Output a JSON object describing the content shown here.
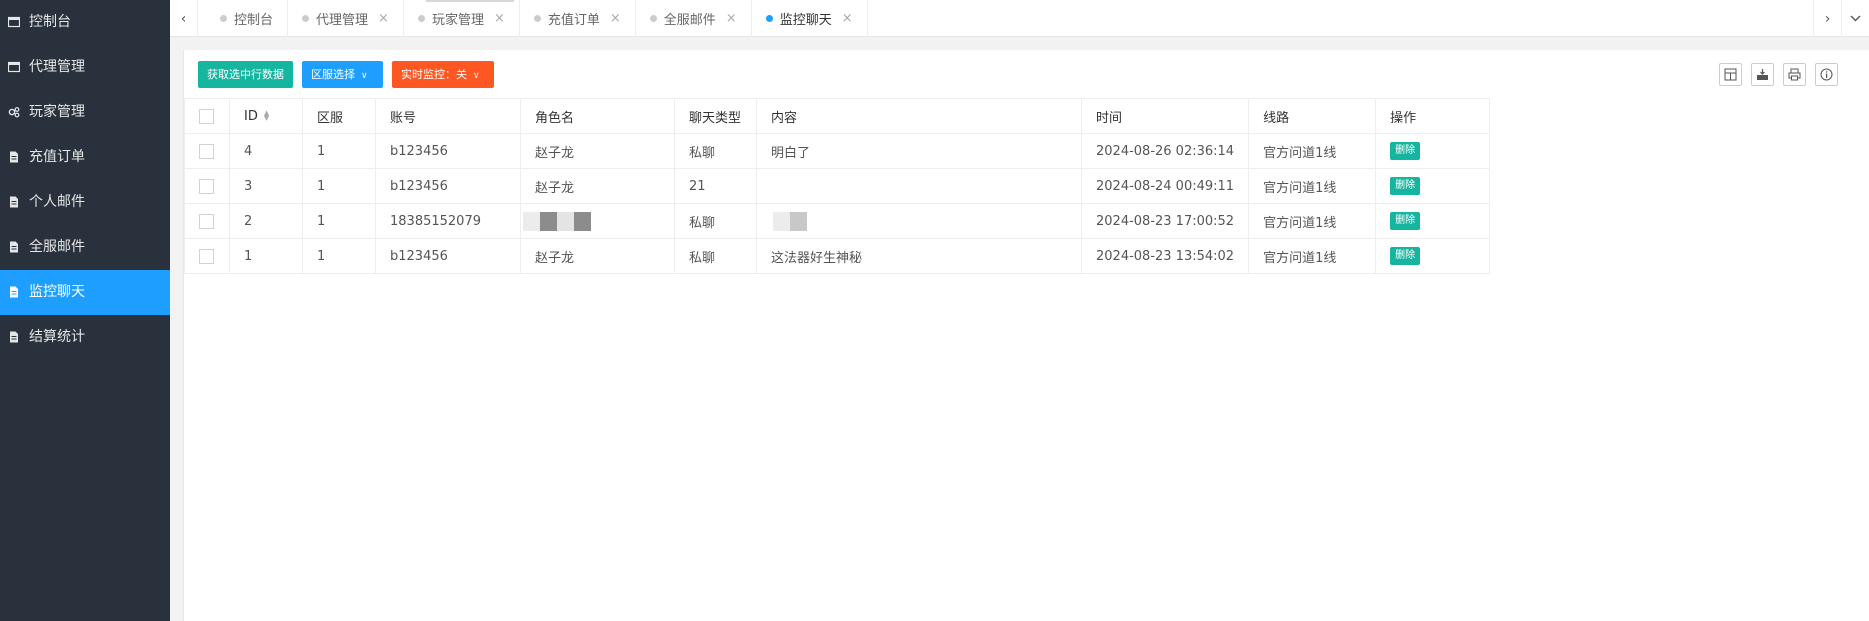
{
  "sidebar": {
    "items": [
      {
        "label": "控制台",
        "icon": "window-icon"
      },
      {
        "label": "代理管理",
        "icon": "window-icon"
      },
      {
        "label": "玩家管理",
        "icon": "gears-icon"
      },
      {
        "label": "充值订单",
        "icon": "file-icon"
      },
      {
        "label": "个人邮件",
        "icon": "file-icon"
      },
      {
        "label": "全服邮件",
        "icon": "file-icon"
      },
      {
        "label": "监控聊天",
        "icon": "file-icon",
        "active": true
      },
      {
        "label": "结算统计",
        "icon": "file-icon"
      }
    ]
  },
  "tabs": {
    "prev_icon": "chevron-left-icon",
    "next_icon": "chevron-right-icon",
    "menu_icon": "chevron-down-icon",
    "items": [
      {
        "label": "控制台",
        "closable": false
      },
      {
        "label": "代理管理",
        "closable": true
      },
      {
        "label": "玩家管理",
        "closable": true
      },
      {
        "label": "充值订单",
        "closable": true
      },
      {
        "label": "全服邮件",
        "closable": true
      },
      {
        "label": "监控聊天",
        "closable": true,
        "active": true
      }
    ],
    "close_glyph": "×"
  },
  "toolbar": {
    "get_selected_label": "获取选中行数据",
    "server_select_label": "区服选择",
    "live_monitor_label": "实时监控：关",
    "right_icons": [
      "columns-filter-icon",
      "export-icon",
      "print-icon",
      "info-icon"
    ]
  },
  "table": {
    "headers": [
      "ID",
      "区服",
      "账号",
      "角色名",
      "聊天类型",
      "内容",
      "时间",
      "线路",
      "操作"
    ],
    "rows": [
      {
        "id": "4",
        "server": "1",
        "account": "b123456",
        "role": "赵子龙",
        "type": "私聊",
        "content": "明白了",
        "time": "2024-08-26 02:36:14",
        "line": "官方问道1线",
        "action": "删除"
      },
      {
        "id": "3",
        "server": "1",
        "account": "b123456",
        "role": "赵子龙",
        "type": "21",
        "content": "",
        "time": "2024-08-24 00:49:11",
        "line": "官方问道1线",
        "action": "删除"
      },
      {
        "id": "2",
        "server": "1",
        "account": "18385152079",
        "role": "",
        "type": "私聊",
        "content": "",
        "time": "2024-08-23 17:00:52",
        "line": "官方问道1线",
        "action": "删除",
        "masked": true
      },
      {
        "id": "1",
        "server": "1",
        "account": "b123456",
        "role": "赵子龙",
        "type": "私聊",
        "content": "这法器好生神秘",
        "time": "2024-08-23 13:54:02",
        "line": "官方问道1线",
        "action": "删除"
      }
    ]
  },
  "colors": {
    "sidebar_bg": "#28313c",
    "accent": "#1e9fff",
    "green": "#16b5a0",
    "orange": "#ff5722"
  }
}
